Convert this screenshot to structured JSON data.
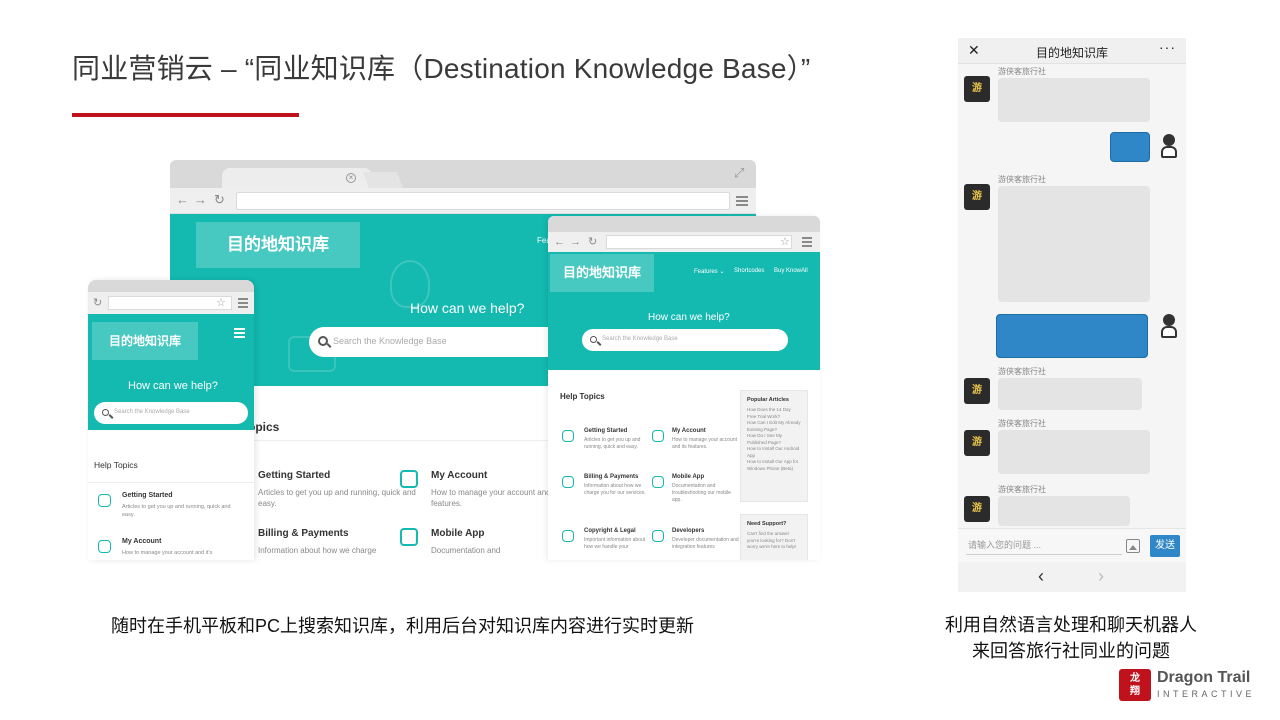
{
  "slide": {
    "title": "同业营销云 – “同业知识库（Destination Knowledge Base）”",
    "accent_color": "#c0121c",
    "caption_left": "随时在手机平板和PC上搜索知识库，利用后台对知识库内容进行实时更新",
    "caption_right_line1": "利用自然语言处理和聊天机器人",
    "caption_right_line2": "来回答旅行社同业的问题"
  },
  "desktop": {
    "brand": "目的地知识库",
    "nav_link": "Fea",
    "help_title": "How can we help?",
    "search_placeholder": "Search the Knowledge Base",
    "topics_heading": "opics",
    "items": [
      {
        "title": "Getting Started",
        "desc": "Articles to get you up and running, quick and easy."
      },
      {
        "title": "My Account",
        "desc": "How to manage your account and its features."
      },
      {
        "title": "Billing & Payments",
        "desc": "Information about how we charge"
      },
      {
        "title": "Mobile App",
        "desc": "Documentation and"
      }
    ]
  },
  "tablet": {
    "brand": "目的地知识库",
    "nav": [
      "Features ⌄",
      "Shortcodes",
      "Buy KnowAll"
    ],
    "help_title": "How can we help?",
    "search_placeholder": "Search the Knowledge Base",
    "topics_heading": "Help Topics",
    "items": [
      {
        "title": "Getting Started",
        "desc": "Articles to get you up and running, quick and easy."
      },
      {
        "title": "My Account",
        "desc": "How to manage your account and its features."
      },
      {
        "title": "Billing & Payments",
        "desc": "Information about how we charge you for our services."
      },
      {
        "title": "Mobile App",
        "desc": "Documentation and troubleshooting our mobile app."
      },
      {
        "title": "Copyright & Legal",
        "desc": "Important information about how we handle your"
      },
      {
        "title": "Developers",
        "desc": "Developer documentation and integration features"
      }
    ],
    "popular_heading": "Popular Articles",
    "popular_list": "How Does the 14 Day Free Trial Work?\nHow Can I Edit My Already Existing Page?\nHow Do I See My Published Page?\nHow to Install Our Android App\nHow to Install Our App for Windows Phone (Beta)",
    "support_heading": "Need Support?",
    "support_text": "Can't find the answer you're looking for? Don't worry we're here to help!"
  },
  "mobile": {
    "brand": "目的地知识库",
    "help_title": "How can we help?",
    "search_placeholder": "Search the Knowledge Base",
    "topics_heading": "Help Topics",
    "items": [
      {
        "title": "Getting Started",
        "desc": "Articles to get you up and running, quick and easy."
      },
      {
        "title": "My Account",
        "desc": "How to manage your account and it's"
      }
    ]
  },
  "chat": {
    "title": "目的地知识库",
    "close_glyph": "✕",
    "more_glyph": "···",
    "bot_name": "游侠客旅行社",
    "input_placeholder": "请输入您的问题 ...",
    "send_label": "发送",
    "bubble_in_color": "#e4e4e4",
    "bubble_out_color": "#2f87c8"
  },
  "logo": {
    "mark": "龙\n翔",
    "name": "Dragon Trail",
    "sub": "INTERACTIVE"
  }
}
